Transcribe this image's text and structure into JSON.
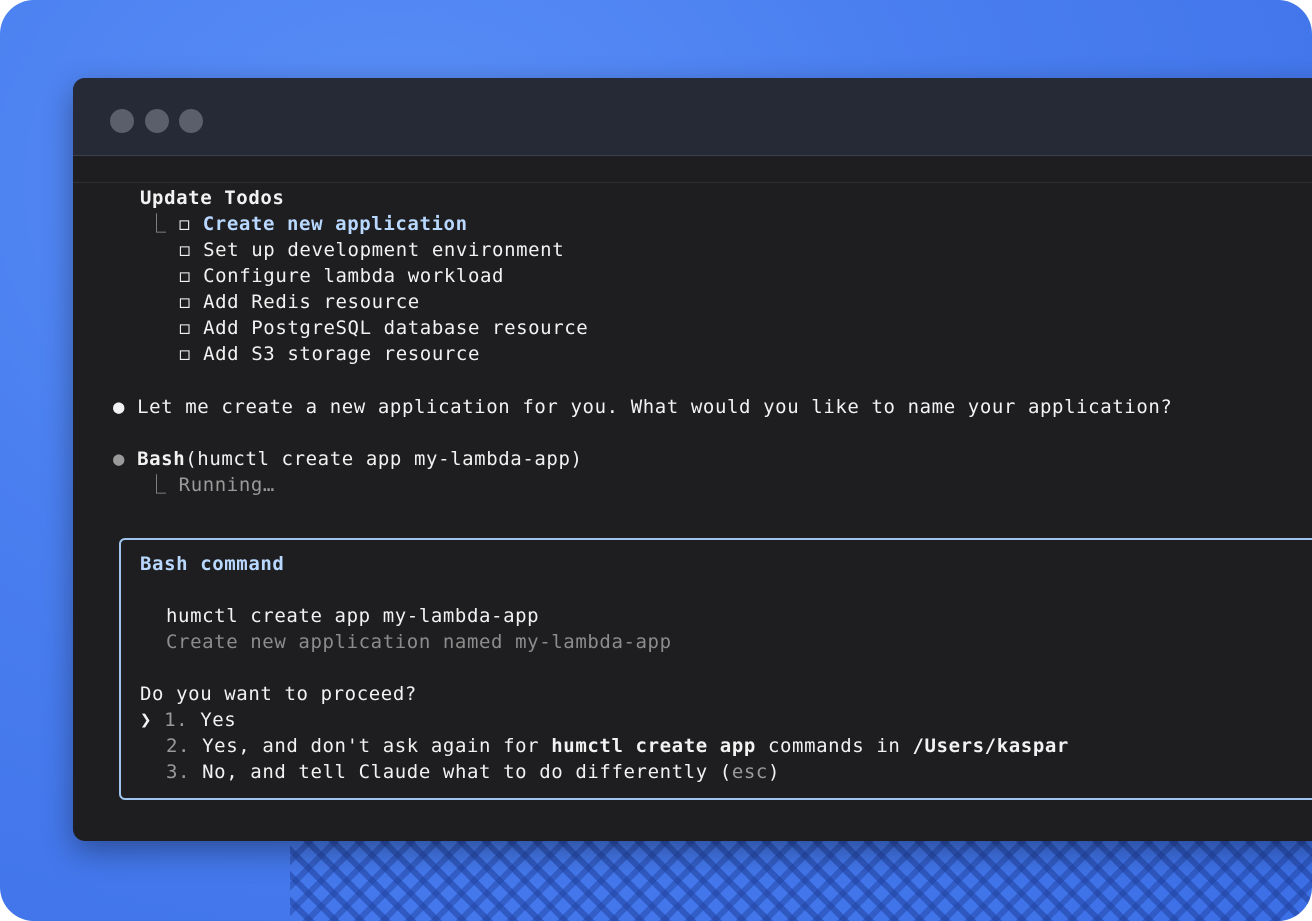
{
  "todos": {
    "heading": "Update Todos",
    "items": [
      {
        "label": "Create new application",
        "active": true
      },
      {
        "label": "Set up development environment",
        "active": false
      },
      {
        "label": "Configure lambda workload",
        "active": false
      },
      {
        "label": "Add Redis resource",
        "active": false
      },
      {
        "label": "Add PostgreSQL database resource",
        "active": false
      },
      {
        "label": "Add S3 storage resource",
        "active": false
      }
    ]
  },
  "assistant_message": "Let me create a new application for you. What would you like to name your application?",
  "tool_call": {
    "tool": "Bash",
    "args": "(humctl create app my-lambda-app)",
    "status": "Running…"
  },
  "prompt": {
    "title": "Bash command",
    "command": "humctl create app my-lambda-app",
    "description": "Create new application named my-lambda-app",
    "question": "Do you want to proceed?",
    "options": [
      {
        "num": "1.",
        "text": "Yes"
      },
      {
        "num": "2.",
        "pre": "Yes, and don't ask again for ",
        "cmd": "humctl create app",
        "mid": " commands in ",
        "path": "/Users/kaspar"
      },
      {
        "num": "3.",
        "pre": "No, and tell Claude what to do differently (",
        "key": "esc",
        "post": ")"
      }
    ]
  },
  "icons": {
    "bullet": "●",
    "checkbox": "◻",
    "tree_branch": "⎿",
    "selector": "❯"
  },
  "colors": {
    "background_blue": "#4a7ff0",
    "terminal_bg": "#1e1e20",
    "titlebar_bg": "#262a36",
    "accent_blue": "#b9d8ff",
    "box_border": "#9fc4ee"
  }
}
